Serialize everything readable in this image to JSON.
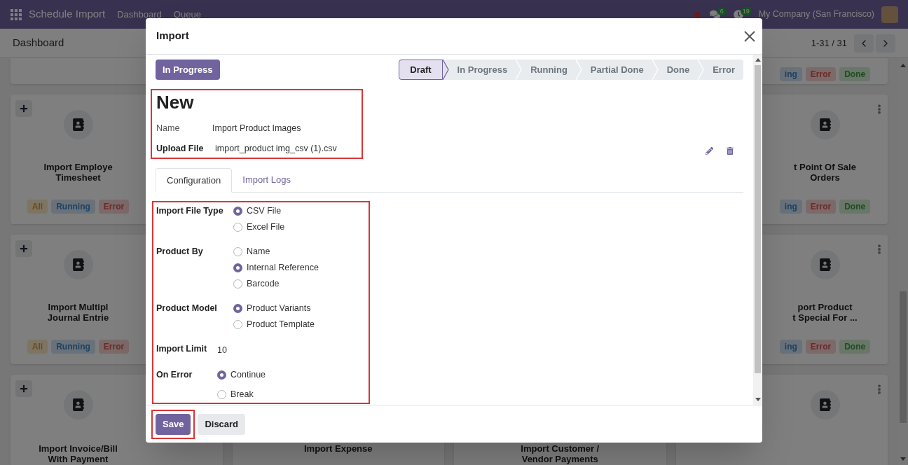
{
  "navbar": {
    "app_name": "Schedule Import",
    "menu": [
      "Dashboard",
      "Queue"
    ],
    "messages_count": "6",
    "activities_count": "19",
    "company": "My Company (San Francisco)"
  },
  "control_panel": {
    "breadcrumb": "Dashboard",
    "pager": "1-31 / 31"
  },
  "kanban": {
    "columns": [
      {
        "cards": [
          {
            "kind": "partial"
          },
          {
            "kind": "full",
            "title_lines": [
              "Import Employe",
              "Timesheet"
            ],
            "badges": [
              {
                "label": "All",
                "kind": "all"
              },
              {
                "label": "Running",
                "kind": "running"
              },
              {
                "label": "Error",
                "kind": "error"
              }
            ]
          },
          {
            "kind": "full",
            "title_lines": [
              "Import Multipl",
              "Journal Entrie"
            ],
            "badges": [
              {
                "label": "All",
                "kind": "all"
              },
              {
                "label": "Running",
                "kind": "running"
              },
              {
                "label": "Error",
                "kind": "error"
              }
            ]
          },
          {
            "kind": "bottom",
            "title_lines": [
              "Import Invoice/Bill",
              "With Payment"
            ]
          }
        ]
      },
      {
        "cards": [
          {
            "kind": "partial"
          },
          {
            "kind": "full"
          },
          {
            "kind": "full"
          },
          {
            "kind": "bottom",
            "title_lines": [
              "Import Expense"
            ]
          }
        ]
      },
      {
        "cards": [
          {
            "kind": "partial"
          },
          {
            "kind": "full"
          },
          {
            "kind": "full"
          },
          {
            "kind": "bottom",
            "title_lines": [
              "Import Customer /",
              "Vendor Payments"
            ]
          }
        ]
      },
      {
        "cards": [
          {
            "kind": "partial",
            "badges": [
              {
                "label": "ing",
                "kind": "running"
              },
              {
                "label": "Error",
                "kind": "error"
              },
              {
                "label": "Done",
                "kind": "done"
              }
            ]
          },
          {
            "kind": "full",
            "title_lines": [
              "t Point Of Sale",
              "Orders"
            ],
            "badges": [
              {
                "label": "ing",
                "kind": "running"
              },
              {
                "label": "Error",
                "kind": "error"
              },
              {
                "label": "Done",
                "kind": "done"
              }
            ]
          },
          {
            "kind": "full",
            "title_lines": [
              "port Product",
              "t Special For ..."
            ],
            "badges": [
              {
                "label": "ing",
                "kind": "running"
              },
              {
                "label": "Error",
                "kind": "error"
              },
              {
                "label": "Done",
                "kind": "done"
              }
            ]
          },
          {
            "kind": "bottom"
          }
        ]
      }
    ]
  },
  "modal": {
    "title": "Import",
    "status_button": "In Progress",
    "stages": [
      {
        "label": "Draft",
        "selected": true
      },
      {
        "label": "In Progress",
        "selected": false
      },
      {
        "label": "Running",
        "selected": false
      },
      {
        "label": "Partial Done",
        "selected": false
      },
      {
        "label": "Done",
        "selected": false
      },
      {
        "label": "Error",
        "selected": false
      }
    ],
    "record_title": "New",
    "fields": [
      {
        "kind": "char",
        "label": "Name",
        "value": "Import Product Images"
      },
      {
        "kind": "binary",
        "label": "Upload File",
        "value": "import_product img_csv (1).csv"
      }
    ],
    "tabs": [
      {
        "label": "Configuration",
        "selected": true
      },
      {
        "label": "Import Logs",
        "selected": false
      }
    ],
    "config_groups": [
      [
        {
          "kind": "radio",
          "label": "Import File Type",
          "options": [
            {
              "label": "CSV File",
              "selected": true
            },
            {
              "label": "Excel File",
              "selected": false
            }
          ]
        },
        {
          "kind": "radio",
          "label": "Product By",
          "options": [
            {
              "label": "Name",
              "selected": false
            },
            {
              "label": "Internal Reference",
              "selected": true
            },
            {
              "label": "Barcode",
              "selected": false
            }
          ]
        },
        {
          "kind": "radio",
          "label": "Product Model",
          "options": [
            {
              "label": "Product Variants",
              "selected": true
            },
            {
              "label": "Product Template",
              "selected": false
            }
          ]
        }
      ],
      [
        {
          "kind": "text",
          "label": "Import Limit",
          "value": "10"
        },
        {
          "kind": "radio",
          "label": "On Error",
          "options": [
            {
              "label": "Continue",
              "selected": true
            },
            {
              "label": "Break",
              "selected": false
            }
          ]
        }
      ]
    ],
    "buttons": [
      {
        "label": "Save",
        "kind": "primary"
      },
      {
        "label": "Discard",
        "kind": "secondary"
      }
    ]
  }
}
